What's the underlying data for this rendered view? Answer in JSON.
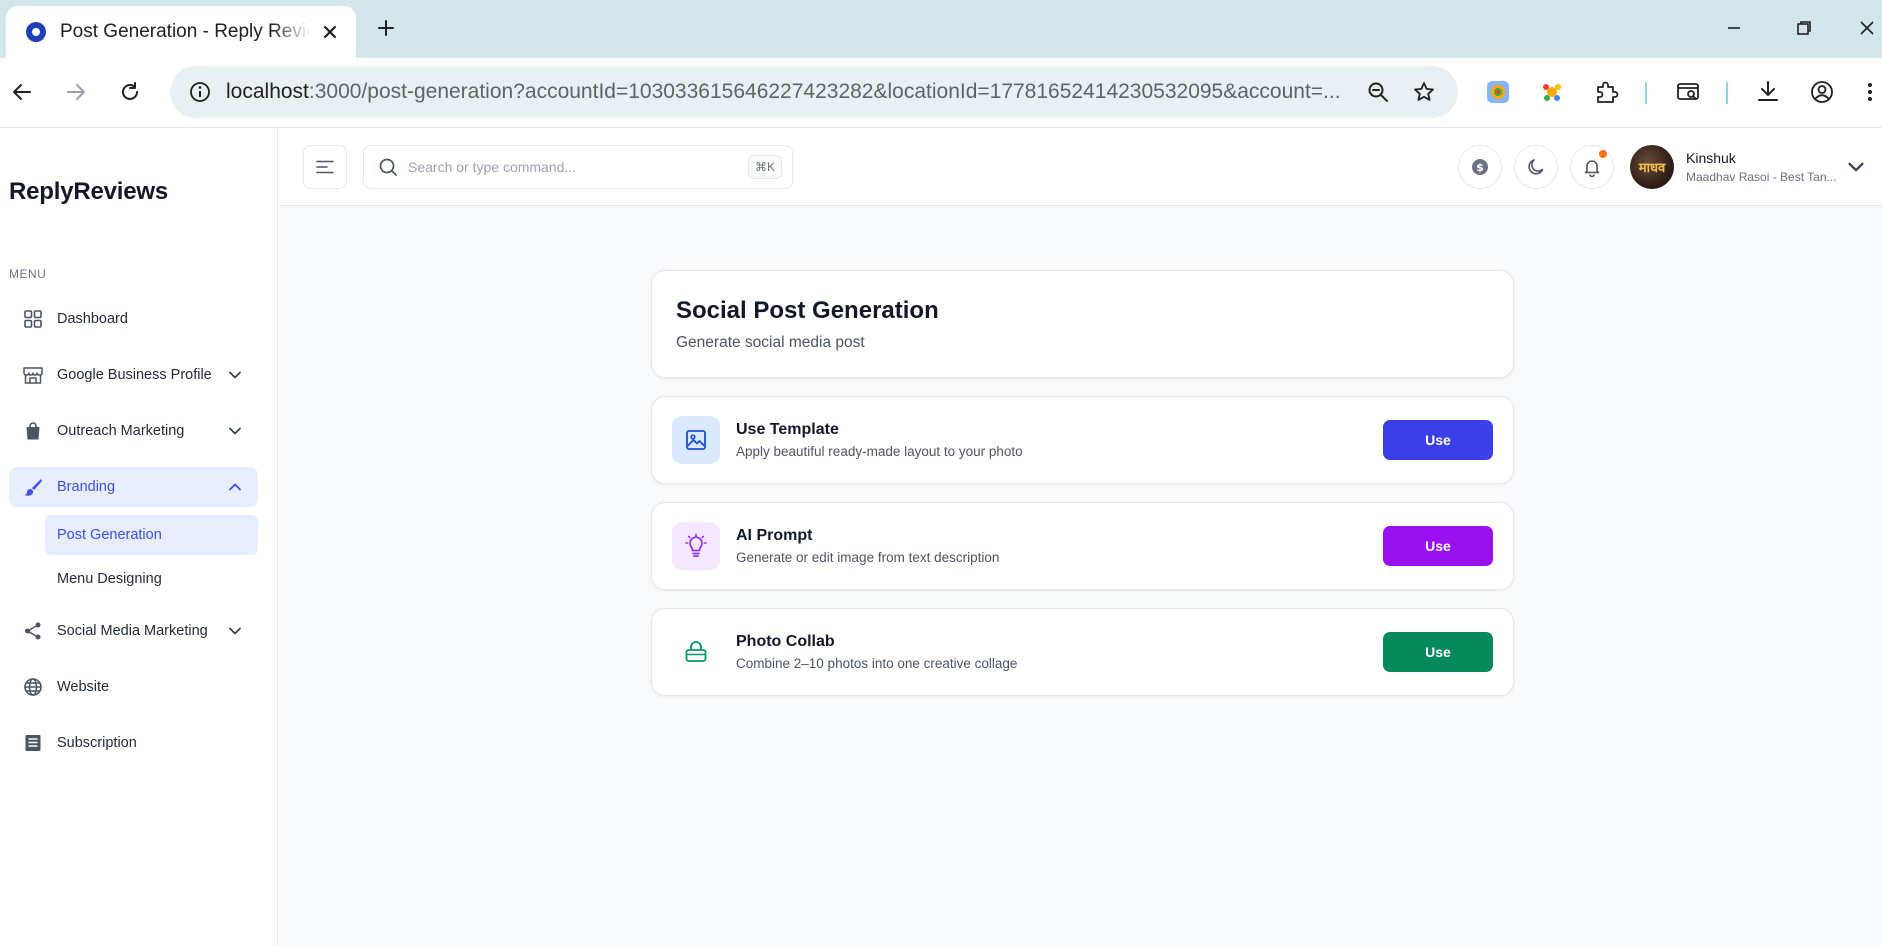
{
  "browser": {
    "tab_title": "Post Generation - Reply Reviews",
    "url_host": "localhost",
    "url_rest": ":3000/post-generation?accountId=103033615646227423282&locationId=17781652414230532095&account=..."
  },
  "sidebar": {
    "brand": "ReplyReviews",
    "menu_label": "MENU",
    "items": [
      {
        "label": "Dashboard",
        "icon": "grid-icon"
      },
      {
        "label": "Google Business Profile",
        "icon": "store-icon"
      },
      {
        "label": "Outreach Marketing",
        "icon": "shopping-bag-icon"
      },
      {
        "label": "Branding",
        "icon": "brush-icon"
      },
      {
        "label": "Social Media Marketing",
        "icon": "share-icon"
      },
      {
        "label": "Website",
        "icon": "globe-icon"
      },
      {
        "label": "Subscription",
        "icon": "list-icon"
      }
    ],
    "branding_sub": [
      "Post Generation",
      "Menu Designing"
    ],
    "active_item": "Branding",
    "active_sub": "Post Generation"
  },
  "topbar": {
    "search_placeholder": "Search or type command...",
    "shortcut": "⌘K",
    "user_name": "Kinshuk",
    "user_business": "Maadhav Rasoi - Best Tan...",
    "avatar_text": "माधव"
  },
  "page": {
    "title": "Social Post Generation",
    "subtitle": "Generate social media post",
    "options": [
      {
        "title": "Use Template",
        "desc": "Apply beautiful ready-made layout to your photo",
        "button": "Use",
        "color": "#3b3fe8",
        "icon_bg": "#dbeafe",
        "icon": "image-icon"
      },
      {
        "title": "AI Prompt",
        "desc": "Generate or edit image from text description",
        "button": "Use",
        "color": "#9a11f0",
        "icon_bg": "#f3e8ff",
        "icon": "lightbulb-icon"
      },
      {
        "title": "Photo Collab",
        "desc": "Combine 2–10 photos into one creative collage",
        "button": "Use",
        "color": "#078a5b",
        "icon_bg": "#ffffff",
        "icon": "collage-icon"
      }
    ]
  },
  "colors": {
    "accent": "#3b4fe0",
    "active_bg": "#e8eeff",
    "notification": "#f97316"
  }
}
